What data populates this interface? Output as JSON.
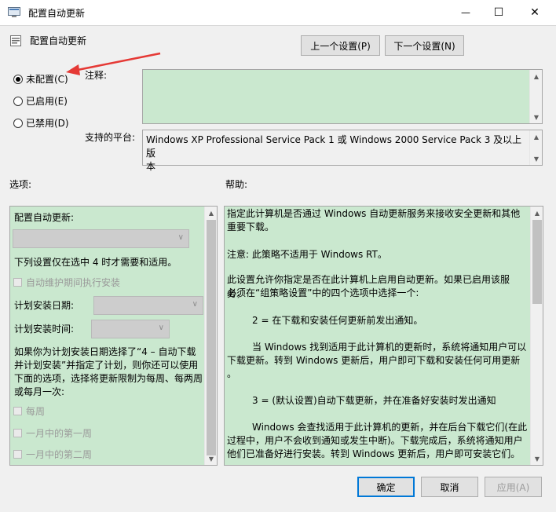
{
  "window": {
    "title": "配置自动更新",
    "header": "配置自动更新",
    "minimize": "—",
    "maximize": "☐",
    "close": "✕"
  },
  "nav": {
    "prev": "上一个设置(P)",
    "next": "下一个设置(N)"
  },
  "state": {
    "options": [
      {
        "label": "未配置(C)",
        "selected": true
      },
      {
        "label": "已启用(E)",
        "selected": false
      },
      {
        "label": "已禁用(D)",
        "selected": false
      }
    ]
  },
  "comment_label": "注释:",
  "platform_label": "支持的平台:",
  "platform_text_1": "Windows XP Professional Service Pack 1 或 Windows 2000 Service Pack 3 及以上版",
  "platform_text_2": "本",
  "options_label": "选项:",
  "help_label": "帮助:",
  "options_panel": {
    "configure_label": "配置自动更新:",
    "note": "下列设置仅在选中 4 时才需要和适用。",
    "maintenance": "自动维护期间执行安装",
    "schedule_day": "计划安装日期:",
    "schedule_time": "计划安装时间:",
    "para_1": "如果你为计划安装日期选择了“4 – 自动下载",
    "para_2": "并计划安装”并指定了计划，则你还可以使用",
    "para_3": "下面的选项，选择将更新限制为每周、每两周",
    "para_4": "或每月一次:",
    "weekly": "每周",
    "first_week": "一月中的第一周",
    "second_week": "一月中的第二周"
  },
  "help_text": {
    "l1": "指定此计算机是否通过 Windows 自动更新服务来接收安全更新和其他",
    "l2": "重要下载。",
    "l3": "注意: 此策略不适用于 Windows RT。",
    "l4": "此设置允许你指定是否在此计算机上启用自动更新。如果已启用该服务，",
    "l5": "必须在“组策略设置”中的四个选项中选择一个:",
    "l6": "2 = 在下载和安装任何更新前发出通知。",
    "l7": "当 Windows 找到适用于此计算机的更新时，系统将通知用户可以",
    "l8": "下载更新。转到 Windows 更新后，用户即可下载和安装任何可用更新",
    "l9": "。",
    "l10": "3 = (默认设置)自动下载更新，并在准备好安装时发出通知",
    "l11": "Windows 会查找适用于此计算机的更新，并在后台下载它们(在此",
    "l12": "过程中，用户不会收到通知或发生中断)。下载完成后，系统将通知用户",
    "l13": "他们已准备好进行安装。转到 Windows 更新后，用户即可安装它们。"
  },
  "buttons": {
    "ok": "确定",
    "cancel": "取消",
    "apply": "应用(A)"
  },
  "colors": {
    "panel_green": "#cae8cf",
    "accent": "#0078d7",
    "annotation_arrow": "#e53935"
  }
}
